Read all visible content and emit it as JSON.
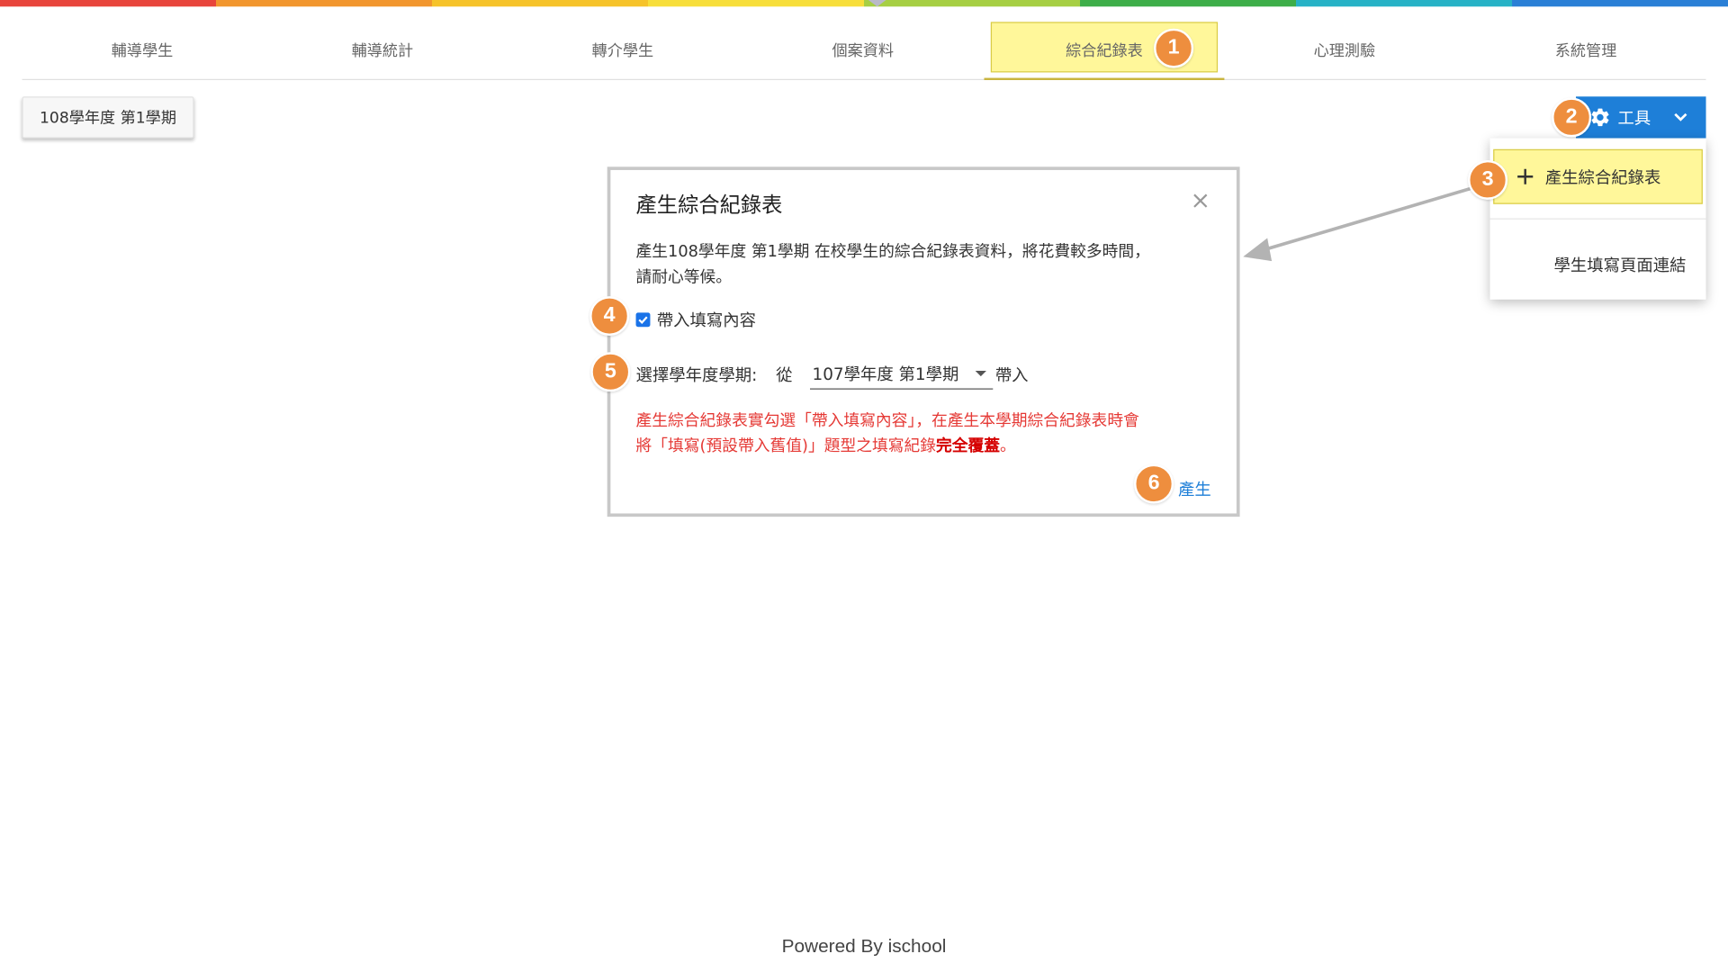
{
  "nav": {
    "items": [
      {
        "label": "輔導學生"
      },
      {
        "label": "輔導統計"
      },
      {
        "label": "轉介學生"
      },
      {
        "label": "個案資料"
      },
      {
        "label": "綜合紀錄表"
      },
      {
        "label": "心理測驗"
      },
      {
        "label": "系統管理"
      }
    ],
    "active_index": 4
  },
  "semester_button": {
    "label": "108學年度 第1學期"
  },
  "tools_button": {
    "label": "工具",
    "icon": "gear-icon"
  },
  "tools_menu": {
    "items": [
      {
        "label": "產生綜合紀錄表",
        "icon": "plus-icon"
      },
      {
        "label": "學生填寫頁面連結"
      }
    ]
  },
  "dialog": {
    "title": "產生綜合紀錄表",
    "close_symbol": "×",
    "description_line1": "產生108學年度 第1學期 在校學生的綜合紀錄表資料，將花費較多時間，",
    "description_line2": "請耐心等候。",
    "checkbox_label": "帶入填寫內容",
    "checkbox_checked": true,
    "select_label": "選擇學年度學期:",
    "select_from": "從",
    "select_value": "107學年度 第1學期",
    "select_suffix": "帶入",
    "warning_line1": "產生綜合紀錄表實勾選「帶入填寫內容」，在產生本學期綜合紀錄表時會",
    "warning_line2_prefix": "將「填寫(預設帶入舊值)」題型之填寫紀錄",
    "warning_bold": "完全覆蓋",
    "warning_end": "。",
    "produce_label": "產生"
  },
  "badges": [
    "1",
    "2",
    "3",
    "4",
    "5",
    "6"
  ],
  "footer": "Powered By ischool",
  "colors": {
    "highlight": "#fff79a",
    "accent_blue": "#1e7fd8",
    "badge_orange": "#ee8e3e",
    "warning_red": "#e53935",
    "rainbow": [
      "#e8453c",
      "#f2962e",
      "#f6c32a",
      "#f7de3a",
      "#a6cf43",
      "#3dae49",
      "#26b2c6",
      "#2a7fd6"
    ]
  }
}
